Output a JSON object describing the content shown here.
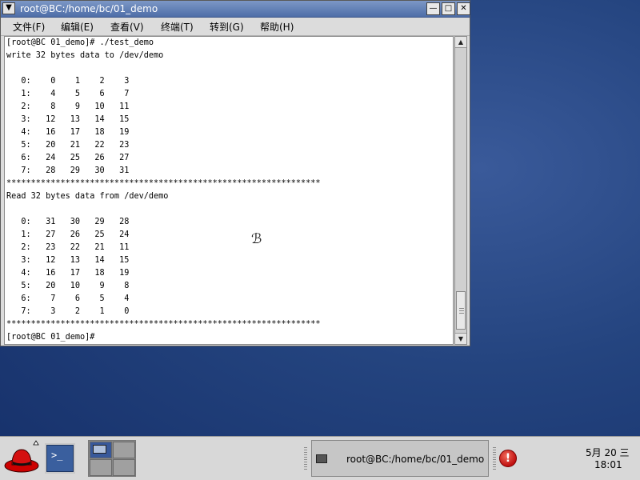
{
  "window": {
    "title": "root@BC:/home/bc/01_demo",
    "menu": [
      "文件(F)",
      "编辑(E)",
      "查看(V)",
      "终端(T)",
      "转到(G)",
      "帮助(H)"
    ]
  },
  "terminal": {
    "lines": [
      "[root@BC 01_demo]# ./test_demo",
      "write 32 bytes data to /dev/demo",
      "",
      "   0:    0    1    2    3",
      "   1:    4    5    6    7",
      "   2:    8    9   10   11",
      "   3:   12   13   14   15",
      "   4:   16   17   18   19",
      "   5:   20   21   22   23",
      "   6:   24   25   26   27",
      "   7:   28   29   30   31",
      "****************************************************************",
      "Read 32 bytes data from /dev/demo",
      "",
      "   0:   31   30   29   28",
      "   1:   27   26   25   24",
      "   2:   23   22   21   11",
      "   3:   12   13   14   15",
      "   4:   16   17   18   19",
      "   5:   20   10    9    8",
      "   6:    7    6    5    4",
      "   7:    3    2    1    0",
      "****************************************************************",
      "[root@BC 01_demo]#"
    ]
  },
  "panel": {
    "task_label": "root@BC:/home/bc/01_demo",
    "clock_date": "5月 20 三",
    "clock_time": "18:01",
    "alert_glyph": "!"
  },
  "icons": {
    "window_menu": "chevron-down-icon",
    "minimize": "minimize-icon",
    "maximize": "maximize-icon",
    "close": "close-icon",
    "launcher": "redhat-menu-icon",
    "terminal_launcher": "terminal-icon",
    "alert": "update-alert-icon"
  }
}
